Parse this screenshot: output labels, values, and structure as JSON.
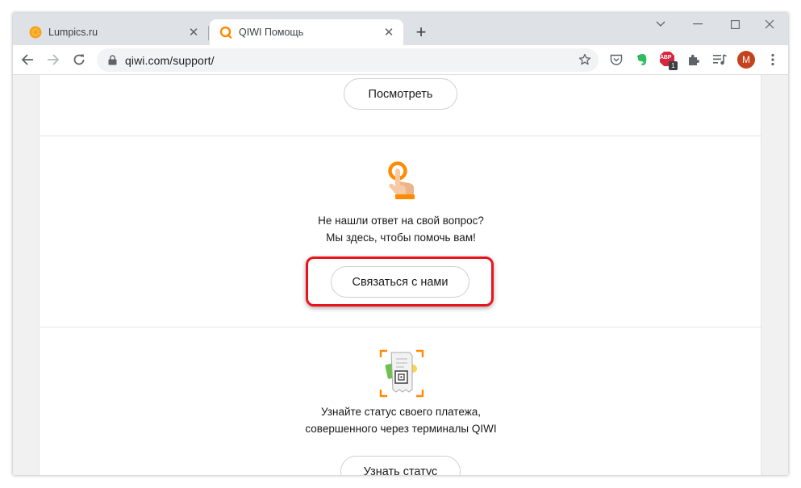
{
  "browser": {
    "tabs": [
      {
        "title": "Lumpics.ru",
        "active": false,
        "icon": "orange-icon"
      },
      {
        "title": "QIWI Помощь",
        "active": true,
        "icon": "qiwi-icon"
      }
    ],
    "url": "qiwi.com/support/",
    "profile_initial": "M",
    "badge_text": "ABP",
    "badge_count": "1"
  },
  "page": {
    "section1": {
      "button_label": "Посмотреть"
    },
    "section2": {
      "line1": "Не нашли ответ на свой вопрос?",
      "line2": "Мы здесь, чтобы помочь вам!",
      "button_label": "Связаться с нами"
    },
    "section3": {
      "line1": "Узнайте статус своего платежа,",
      "line2": "совершенного через терминалы QIWI",
      "button_label": "Узнать статус"
    }
  },
  "colors": {
    "qiwi_orange": "#ff8c00",
    "highlight": "#e8141b"
  }
}
